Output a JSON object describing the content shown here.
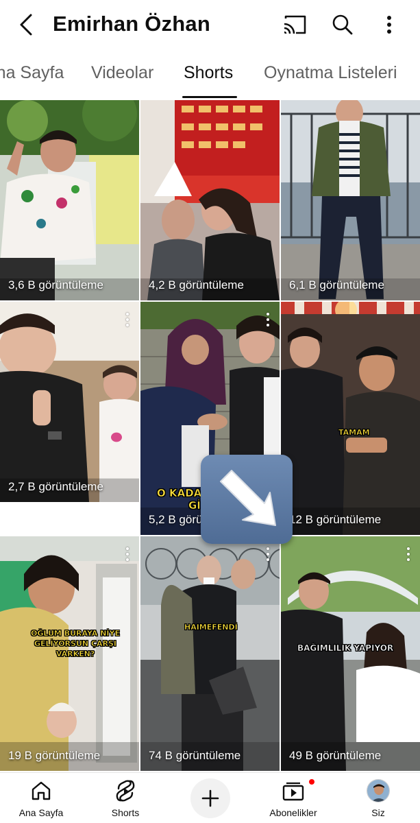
{
  "header": {
    "title": "Emirhan Özhan"
  },
  "tabs": [
    {
      "label": "Ana Sayfa"
    },
    {
      "label": "Videolar"
    },
    {
      "label": "Shorts"
    },
    {
      "label": "Oynatma Listeleri"
    }
  ],
  "shorts": [
    {
      "views": "3,6 B görüntüleme"
    },
    {
      "views": "4,2 B görüntüleme"
    },
    {
      "views": "6,1 B görüntüleme"
    },
    {
      "views": "2,7 B görüntüleme"
    },
    {
      "views": "5,2 B görüntüleme",
      "caption_line1": "O KADAR",
      "caption_line2": "GİRİ"
    },
    {
      "views": "12 B görüntüleme",
      "caption": "TAMAM"
    },
    {
      "views": "19 B görüntüleme",
      "caption": "OĞLUM BURAYA NİYE GELİYORSUN ÇARŞI VARKEN?"
    },
    {
      "views": "74 B görüntüleme",
      "caption": "HAIMEFENDİ"
    },
    {
      "views": "49 B görüntüleme",
      "caption": "BAĞIMLILIK YAPIYOR"
    }
  ],
  "bottom_nav": {
    "home": "Ana Sayfa",
    "shorts": "Shorts",
    "subscriptions": "Abonelikler",
    "you": "Siz"
  }
}
